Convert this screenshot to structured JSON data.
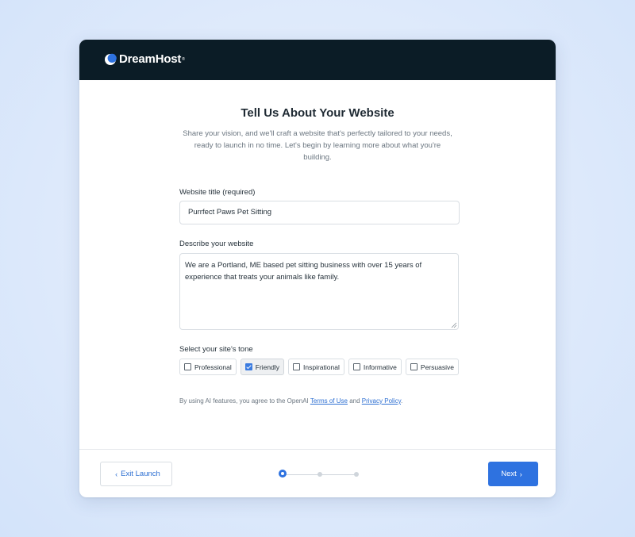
{
  "brand": {
    "name": "DreamHost",
    "mark": "®",
    "accent": "#2e72e0",
    "header_bg": "#0b1c26"
  },
  "page": {
    "title": "Tell Us About Your Website",
    "subtitle_lines": [
      "Share your vision, and we'll craft a website that's perfectly tailored to your needs,",
      "ready to launch in no time. Let's begin by learning more about what you're",
      "building."
    ]
  },
  "form": {
    "website_title": {
      "label": "Website title (required)",
      "value": "Purrfect Paws Pet Sitting"
    },
    "description": {
      "label": "Describe your website",
      "value": "We are a Portland, ME based pet sitting business with over 15 years of experience that treats your animals like family."
    },
    "tone": {
      "label": "Select your site's tone",
      "options": [
        {
          "label": "Professional",
          "checked": false
        },
        {
          "label": "Friendly",
          "checked": true
        },
        {
          "label": "Inspirational",
          "checked": false
        },
        {
          "label": "Informative",
          "checked": false
        },
        {
          "label": "Persuasive",
          "checked": false
        }
      ]
    }
  },
  "legal": {
    "prefix": "By using AI features, you agree to the OpenAI ",
    "terms": "Terms of Use",
    "and": " and ",
    "privacy": "Privacy Policy",
    "suffix": "."
  },
  "footer": {
    "exit_label": "Exit Launch",
    "next_label": "Next",
    "steps": {
      "total": 3,
      "current": 1
    }
  },
  "icons": {
    "back": "chevron-left-icon",
    "next": "chevron-right-icon"
  }
}
